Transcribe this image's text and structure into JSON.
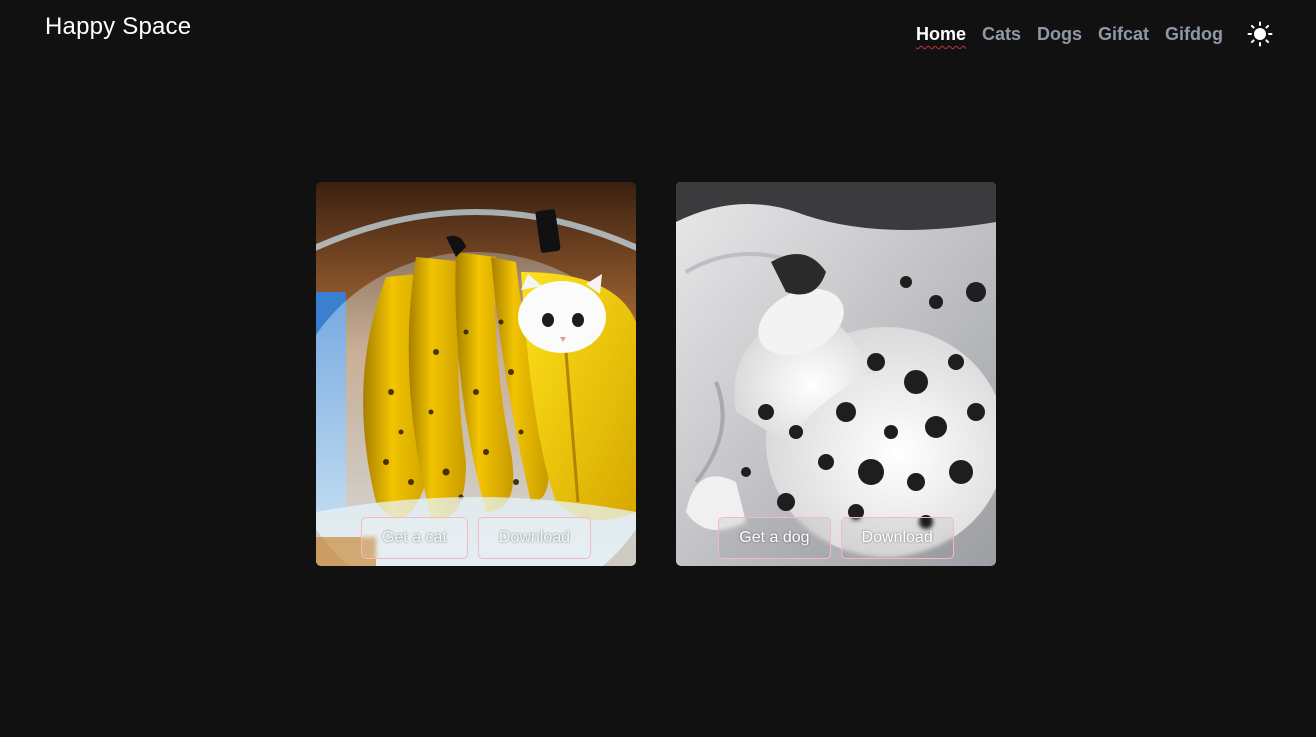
{
  "brand": {
    "title": "Happy Space"
  },
  "nav": {
    "items": [
      {
        "label": "Home",
        "active": true
      },
      {
        "label": "Cats",
        "active": false
      },
      {
        "label": "Dogs",
        "active": false
      },
      {
        "label": "Gifcat",
        "active": false
      },
      {
        "label": "Gifdog",
        "active": false
      }
    ],
    "theme_icon": "sun-icon"
  },
  "cards": {
    "cat": {
      "primary_label": "Get a cat",
      "download_label": "Download",
      "image": "kitten-in-banana-bag-photo"
    },
    "dog": {
      "primary_label": "Get a dog",
      "download_label": "Download",
      "image": "sleeping-dalmatian-photo"
    }
  },
  "colors": {
    "background": "#111111",
    "nav_inactive": "#8f98a6",
    "nav_active": "#ffffff",
    "active_underline": "#c0363a",
    "button_border": "#f4b9c3"
  }
}
